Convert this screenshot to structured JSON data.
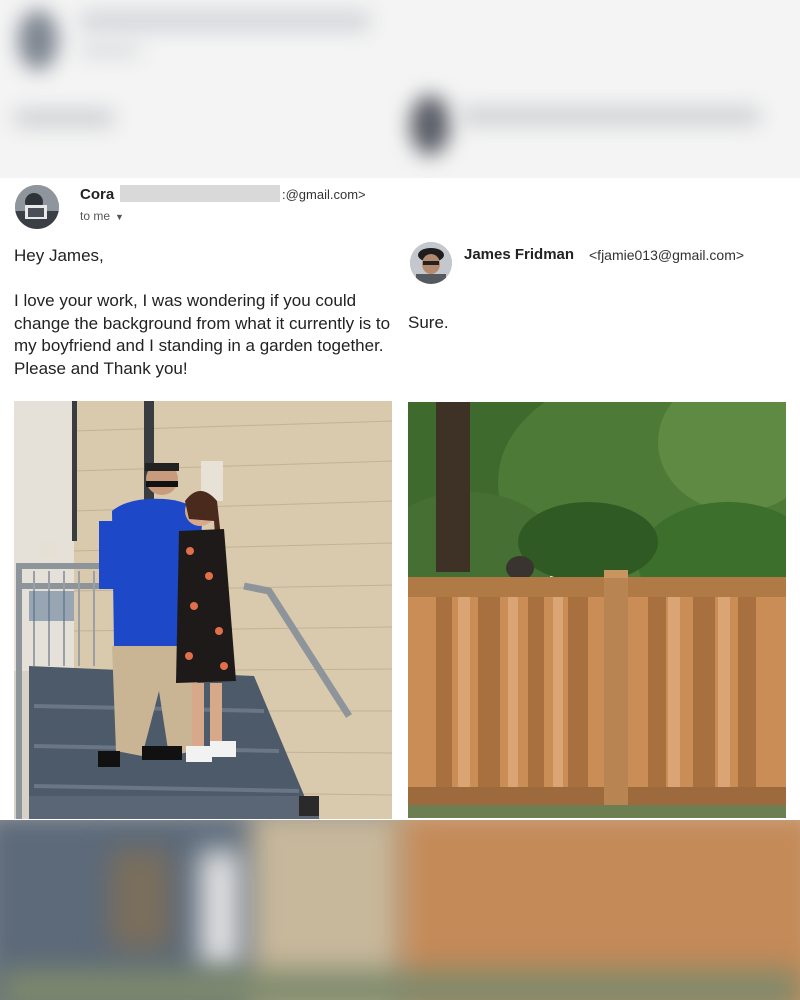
{
  "email": {
    "sender_name": "Cora",
    "sender_email_suffix": ":@gmail.com>",
    "recipient_label": "to me",
    "greeting": "Hey James,",
    "message": "I love your work, I was wondering if you could change the background from what it currently is to my boyfriend and I standing in a garden together. Please and Thank you!"
  },
  "reply": {
    "sender_name": "James Fridman",
    "sender_email": "<fjamie013@gmail.com>",
    "message": "Sure."
  },
  "icons": {
    "recipient_dropdown": "chevron-down-icon",
    "cora_avatar": "avatar-photo",
    "james_avatar": "avatar-photo"
  },
  "colors": {
    "shirt_blue": "#1d48c8",
    "fence_wood": "#c98d55",
    "wall_beige": "#d9c9ad"
  }
}
